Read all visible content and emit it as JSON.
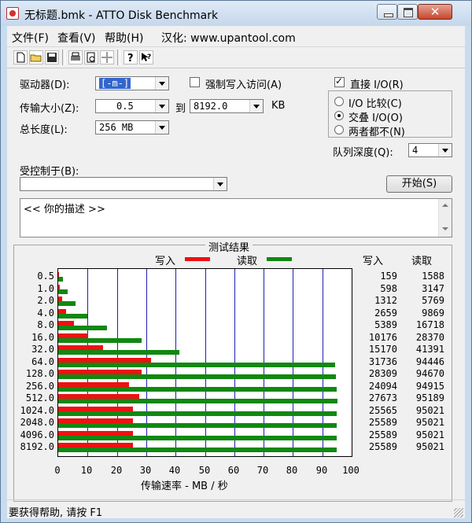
{
  "window": {
    "title": "无标题.bmk - ATTO Disk Benchmark",
    "close_glyph": "✕"
  },
  "menu": {
    "file": "文件(F)",
    "view": "查看(V)",
    "help": "帮助(H)",
    "site": "汉化: www.upantool.com"
  },
  "toolbar": [
    "new-icon",
    "open-icon",
    "save-icon",
    "print-icon",
    "print-preview-icon",
    "move-icon",
    "help-icon",
    "context-help-icon"
  ],
  "form": {
    "drive_label": "驱动器(D):",
    "drive_value": "[-m-]",
    "force_write_label": "强制写入访问(A)",
    "force_write_checked": false,
    "transfer_label": "传输大小(Z):",
    "transfer_from": "0.5",
    "to_label": "到",
    "transfer_to": "8192.0",
    "kb_label": "KB",
    "length_label": "总长度(L):",
    "length_value": "256 MB",
    "direct_io_label": "直接 I/O(R)",
    "direct_io_checked": true,
    "io_compare_label": "I/O 比较(C)",
    "overlap_label": "交叠 I/O(O)",
    "neither_label": "两者都不(N)",
    "io_mode": "overlap",
    "queue_label": "队列深度(Q):",
    "queue_value": "4",
    "controlled_label": "受控制于(B):",
    "controlled_value": "",
    "start_label": "开始(S)",
    "description": "<<  你的描述  >>"
  },
  "results": {
    "title": "测试结果",
    "write_legend": "写入",
    "read_legend": "读取",
    "write_col": "写入",
    "read_col": "读取",
    "xlabel": "传输速率 - MB / 秒",
    "write_color": "#ee1111",
    "read_color": "#118811"
  },
  "chart_data": {
    "type": "bar",
    "orientation": "horizontal",
    "xlabel": "传输速率 - MB / 秒",
    "xlim": [
      0,
      100
    ],
    "xticks": [
      "0",
      "10",
      "20",
      "30",
      "40",
      "50",
      "60",
      "70",
      "80",
      "90",
      "100"
    ],
    "categories": [
      "0.5",
      "1.0",
      "2.0",
      "4.0",
      "8.0",
      "16.0",
      "32.0",
      "64.0",
      "128.0",
      "256.0",
      "512.0",
      "1024.0",
      "2048.0",
      "4096.0",
      "8192.0"
    ],
    "series": [
      {
        "name": "写入",
        "color": "#ee1111",
        "values": [
          0.16,
          0.6,
          1.3,
          2.7,
          5.4,
          10.2,
          15.2,
          31.7,
          28.3,
          24.1,
          27.7,
          25.6,
          25.6,
          25.6,
          25.6
        ]
      },
      {
        "name": "读取",
        "color": "#118811",
        "values": [
          1.6,
          3.1,
          5.8,
          9.9,
          16.7,
          28.4,
          41.4,
          94.4,
          94.7,
          94.9,
          95.2,
          95.0,
          95.0,
          95.0,
          95.0
        ]
      }
    ],
    "table": {
      "write": [
        "159",
        "598",
        "1312",
        "2659",
        "5389",
        "10176",
        "15170",
        "31736",
        "28309",
        "24094",
        "27673",
        "25565",
        "25589",
        "25589",
        "25589"
      ],
      "read": [
        "1588",
        "3147",
        "5769",
        "9869",
        "16718",
        "28370",
        "41391",
        "94446",
        "94670",
        "94915",
        "95189",
        "95021",
        "95021",
        "95021",
        "95021"
      ]
    },
    "grid": true
  },
  "status": "要获得帮助, 请按 F1"
}
